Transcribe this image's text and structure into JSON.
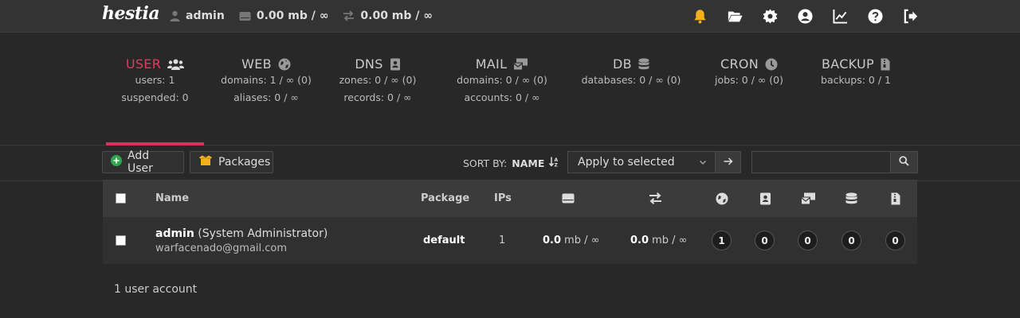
{
  "topbar": {
    "logo": "hestia",
    "user_label": "admin",
    "disk_usage": "0.00 mb / ∞",
    "bandwidth_usage": "0.00 mb / ∞",
    "icons": [
      "bell-icon",
      "folder-icon",
      "gear-icon",
      "user-circle-icon",
      "chart-icon",
      "help-icon",
      "logout-icon"
    ],
    "bell_color": "#f2b01e"
  },
  "overview": {
    "tabs": [
      {
        "title": "USER",
        "icon": "users-icon",
        "lines": [
          "users: 1",
          "suspended: 0"
        ],
        "active": true
      },
      {
        "title": "WEB",
        "icon": "globe-icon",
        "lines": [
          "domains: 1 / ∞ (0)",
          "aliases: 0 / ∞"
        ]
      },
      {
        "title": "DNS",
        "icon": "address-book-icon",
        "lines": [
          "zones: 0 / ∞ (0)",
          "records: 0 / ∞"
        ]
      },
      {
        "title": "MAIL",
        "icon": "mail-bulk-icon",
        "lines": [
          "domains: 0 / ∞ (0)",
          "accounts: 0 / ∞"
        ]
      },
      {
        "title": "DB",
        "icon": "database-icon",
        "lines": [
          "databases: 0 / ∞ (0)"
        ]
      },
      {
        "title": "CRON",
        "icon": "clock-icon",
        "lines": [
          "jobs: 0 / ∞ (0)"
        ]
      },
      {
        "title": "BACKUP",
        "icon": "file-archive-icon",
        "lines": [
          "backups: 0 / 1"
        ]
      }
    ],
    "accent_color": "#d8335e"
  },
  "toolbar": {
    "add_user_label": "Add User",
    "packages_label": "Packages",
    "sort_by_label": "SORT BY:",
    "sort_field": "NAME",
    "bulk_select_value": "Apply to selected",
    "search_placeholder": ""
  },
  "table": {
    "headers": {
      "name": "Name",
      "package": "Package",
      "ips": "IPs"
    },
    "rows": [
      {
        "username": "admin",
        "fullname": "(System Administrator)",
        "email": "warfacenado@gmail.com",
        "package": "default",
        "ips": "1",
        "disk_value": "0.0",
        "disk_suffix": "mb / ∞",
        "bw_value": "0.0",
        "bw_suffix": "mb / ∞",
        "web": "1",
        "dns": "0",
        "mail": "0",
        "db": "0",
        "backups": "0"
      }
    ]
  },
  "footer": {
    "count_label": "1 user account"
  }
}
